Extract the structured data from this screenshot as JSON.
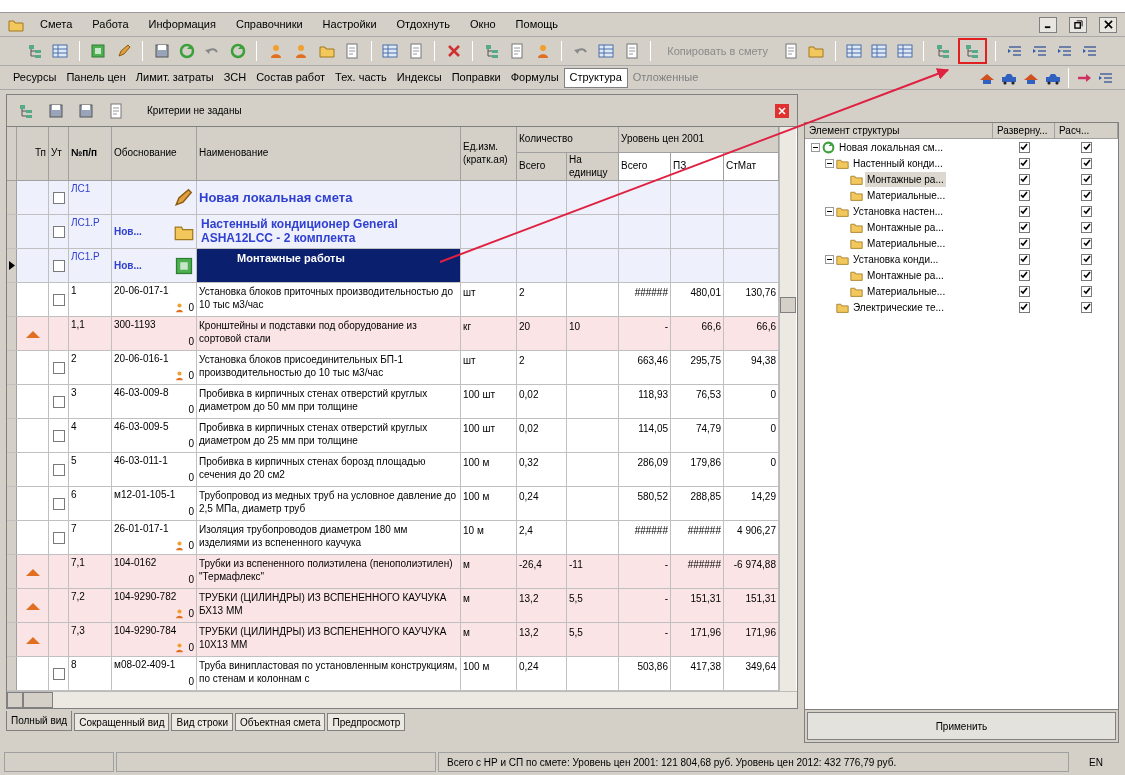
{
  "menu": [
    {
      "label": "Смета"
    },
    {
      "label": "Работа"
    },
    {
      "label": "Информация"
    },
    {
      "label": "Справочники"
    },
    {
      "label": "Настройки"
    },
    {
      "label": "Отдохнуть"
    },
    {
      "label": "Окно"
    },
    {
      "label": "Помощь"
    }
  ],
  "toolbar": {
    "copy_button": {
      "label": "Копировать в смету",
      "disabled": true
    }
  },
  "view_tabs": [
    {
      "label": "Ресурсы",
      "selected": false,
      "disabled": false
    },
    {
      "label": "Панель цен",
      "selected": false,
      "disabled": false
    },
    {
      "label": "Лимит. затраты",
      "selected": false,
      "disabled": false
    },
    {
      "label": "ЗСН",
      "selected": false,
      "disabled": false
    },
    {
      "label": "Состав работ",
      "selected": false,
      "disabled": false
    },
    {
      "label": "Тех. часть",
      "selected": false,
      "disabled": false
    },
    {
      "label": "Индексы",
      "selected": false,
      "disabled": false
    },
    {
      "label": "Поправки",
      "selected": false,
      "disabled": false
    },
    {
      "label": "Формулы",
      "selected": false,
      "disabled": false
    },
    {
      "label": "Структура",
      "selected": true,
      "disabled": false
    },
    {
      "label": "Отложенные",
      "selected": false,
      "disabled": true
    }
  ],
  "filter": {
    "text": "Критерии не заданы"
  },
  "table": {
    "columns": {
      "type": "Тп",
      "mark": "Ут",
      "number": "№п/п",
      "basis": "Обоснование",
      "name": "Наименование",
      "unit": "Ед.изм. (кратк.ая)",
      "quantity": "Количество",
      "qty_total": "Всего",
      "qty_per_unit": "На единицу",
      "price_level": "Уровень цен 2001",
      "price_total": "Всего",
      "price_pz": "ПЗ",
      "price_mat": "СтМат"
    },
    "rows": [
      {
        "kind": "estimate",
        "selected": false,
        "checked": false,
        "number": "ЛС1",
        "name": "Новая локальная смета"
      },
      {
        "kind": "section",
        "selected": false,
        "checked": false,
        "number": "ЛС1.Р",
        "basis": "Нов...",
        "name": "Настенный кондиционер General ASHA12LCC - 2 комплекта"
      },
      {
        "kind": "subsection",
        "selected": true,
        "checked": false,
        "number": "ЛС1.Р",
        "basis": "Нов...",
        "name": "Монтажные работы"
      },
      {
        "kind": "item",
        "selected": false,
        "checked": false,
        "marker": true,
        "number": "1",
        "basis": "20-06-017-1",
        "flag": "0",
        "name": "Установка блоков приточных производительностью до 10 тыс м3/час",
        "unit": "шт",
        "qty_total": "2",
        "price_total": "######",
        "price_pz": "480,01",
        "price_mat": "130,76"
      },
      {
        "kind": "resource",
        "selected": false,
        "marker": false,
        "number": "1,1",
        "basis": "300-1193",
        "flag": "0",
        "name": "Кронштейны и подставки под оборудование из сортовой стали",
        "unit": "кг",
        "qty_total": "20",
        "qty_per_unit": "10",
        "price_total": "-",
        "price_pz": "66,6",
        "price_mat": "66,6"
      },
      {
        "kind": "item",
        "selected": false,
        "checked": false,
        "marker": true,
        "number": "2",
        "basis": "20-06-016-1",
        "flag": "0",
        "name": "Установка блоков присоединительных БП-1 производительностью до 10 тыс м3/час",
        "unit": "шт",
        "qty_total": "2",
        "price_total": "663,46",
        "price_pz": "295,75",
        "price_mat": "94,38"
      },
      {
        "kind": "item",
        "selected": false,
        "checked": false,
        "marker": false,
        "number": "3",
        "basis": "46-03-009-8",
        "flag": "0",
        "name": "Пробивка в кирпичных стенах отверстий круглых диаметром до 50 мм при толщине",
        "unit": "100 шт",
        "qty_total": "0,02",
        "price_total": "118,93",
        "price_pz": "76,53",
        "price_mat": "0"
      },
      {
        "kind": "item",
        "selected": false,
        "checked": false,
        "marker": false,
        "number": "4",
        "basis": "46-03-009-5",
        "flag": "0",
        "name": "Пробивка в кирпичных стенах отверстий круглых диаметром до 25 мм при толщине",
        "unit": "100 шт",
        "qty_total": "0,02",
        "price_total": "114,05",
        "price_pz": "74,79",
        "price_mat": "0"
      },
      {
        "kind": "item",
        "selected": false,
        "checked": false,
        "marker": false,
        "number": "5",
        "basis": "46-03-011-1",
        "flag": "0",
        "name": "Пробивка в кирпичных стенах борозд площадью сечения до 20 см2",
        "unit": "100 м",
        "qty_total": "0,32",
        "price_total": "286,09",
        "price_pz": "179,86",
        "price_mat": "0"
      },
      {
        "kind": "item",
        "selected": false,
        "checked": false,
        "marker": false,
        "number": "6",
        "basis": "м12-01-105-1",
        "flag": "0",
        "name": "Трубопровод из медных труб на условное давление до 2,5 МПа, диаметр труб",
        "unit": "100 м",
        "qty_total": "0,24",
        "price_total": "580,52",
        "price_pz": "288,85",
        "price_mat": "14,29"
      },
      {
        "kind": "item",
        "selected": false,
        "checked": false,
        "marker": true,
        "number": "7",
        "basis": "26-01-017-1",
        "flag": "0",
        "name": "Изоляция трубопроводов диаметром 180 мм изделиями из вспененного каучука",
        "unit": "10 м",
        "qty_total": "2,4",
        "price_total": "######",
        "price_pz": "######",
        "price_mat": "4 906,27"
      },
      {
        "kind": "resource",
        "selected": false,
        "marker": false,
        "number": "7,1",
        "basis": "104-0162",
        "flag": "0",
        "name": "Трубки из вспененного полиэтилена (пенополиэтилен) \"Термафлекс\"",
        "unit": "м",
        "qty_total": "-26,4",
        "qty_per_unit": "-11",
        "price_total": "-",
        "price_pz": "######",
        "price_mat": "-6 974,88"
      },
      {
        "kind": "resource",
        "selected": false,
        "marker": true,
        "number": "7,2",
        "basis": "104-9290-782",
        "flag": "0",
        "name": "ТРУБКИ (ЦИЛИНДРЫ) ИЗ ВСПЕНЕННОГО КАУЧУКА БХ13 ММ",
        "unit": "м",
        "qty_total": "13,2",
        "qty_per_unit": "5,5",
        "price_total": "-",
        "price_pz": "151,31",
        "price_mat": "151,31"
      },
      {
        "kind": "resource",
        "selected": false,
        "marker": true,
        "number": "7,3",
        "basis": "104-9290-784",
        "flag": "0",
        "name": "ТРУБКИ (ЦИЛИНДРЫ) ИЗ ВСПЕНЕННОГО КАУЧУКА 10Х13 ММ",
        "unit": "м",
        "qty_total": "13,2",
        "qty_per_unit": "5,5",
        "price_total": "-",
        "price_pz": "171,96",
        "price_mat": "171,96"
      },
      {
        "kind": "item",
        "selected": false,
        "checked": false,
        "marker": false,
        "number": "8",
        "basis": "м08-02-409-1",
        "flag": "0",
        "name": "Труба винипластовая по установленным конструкциям, по стенам и колоннам с",
        "unit": "100 м",
        "qty_total": "0,24",
        "price_total": "503,86",
        "price_pz": "417,38",
        "price_mat": "349,64"
      }
    ]
  },
  "bottom_tabs": [
    {
      "label": "Полный вид",
      "selected": true
    },
    {
      "label": "Сокращенный вид",
      "selected": false
    },
    {
      "label": "Вид строки",
      "selected": false
    },
    {
      "label": "Объектная смета",
      "selected": false
    },
    {
      "label": "Предпросмотр",
      "selected": false
    }
  ],
  "structure": {
    "columns": [
      "Элемент структуры",
      "Разверну...",
      "Расч..."
    ],
    "tree": [
      {
        "label": "Новая локальная см...",
        "expand": true,
        "calc": true,
        "selected": false,
        "expanded": true,
        "children": [
          {
            "label": "Настенный конди...",
            "expand": true,
            "calc": true,
            "selected": false,
            "expanded": true,
            "children": [
              {
                "label": "Монтажные ра...",
                "expand": true,
                "calc": true,
                "selected": true
              },
              {
                "label": "Материальные...",
                "expand": true,
                "calc": true,
                "selected": false
              }
            ]
          },
          {
            "label": "Установка настен...",
            "expand": true,
            "calc": true,
            "selected": false,
            "expanded": true,
            "children": [
              {
                "label": "Монтажные ра...",
                "expand": true,
                "calc": true,
                "selected": false
              },
              {
                "label": "Материальные...",
                "expand": true,
                "calc": true,
                "selected": false
              }
            ]
          },
          {
            "label": "Установка конди...",
            "expand": true,
            "calc": true,
            "selected": false,
            "expanded": true,
            "children": [
              {
                "label": "Монтажные ра...",
                "expand": true,
                "calc": true,
                "selected": false
              },
              {
                "label": "Материальные...",
                "expand": true,
                "calc": true,
                "selected": false
              }
            ]
          },
          {
            "label": "Электрические те...",
            "expand": true,
            "calc": true,
            "selected": false
          }
        ]
      }
    ],
    "apply_button": {
      "label": "Применить"
    }
  },
  "status_bar": {
    "total": "Всего с НР и СП по смете: Уровень цен 2001: 121 804,68 руб. Уровень цен 2012: 432 776,79 руб.",
    "language": "EN"
  }
}
